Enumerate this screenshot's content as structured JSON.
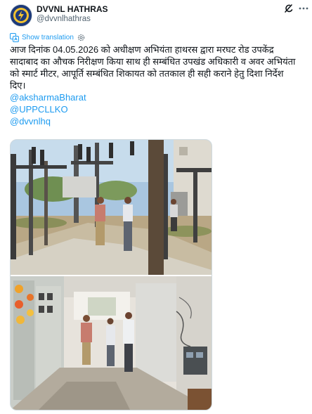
{
  "author": {
    "display_name": "DVVNL HATHRAS",
    "handle": "@dvvnlhathras"
  },
  "header_icons": [
    "grok-icon",
    "more-options-icon"
  ],
  "translation": {
    "label": "Show translation"
  },
  "post": {
    "lines": [
      "आज दिनांक 04.05.2026 को अधीक्षण अभियंता हाथरस द्वारा मरघट रोड उपकेंद्र",
      "सादाबाद का औचक निरीक्षण किया साथ ही सम्बंधित उपखंड अधिकारी व अवर अभियंता",
      "को स्मार्ट मीटर, आपूर्ति सम्बंधित शिकायत को ततकाल ही सही कराने हेतु दिशा निर्देश",
      "दिए।"
    ],
    "mentions": [
      "@aksharmaBharat",
      "@UPPCLLKO",
      "@dvvnlhq"
    ]
  },
  "media": {
    "count": 2,
    "items": [
      "outdoor-substation-photo",
      "indoor-control-room-photo"
    ]
  },
  "colors": {
    "link": "#1d9bf0",
    "text": "#0f1419",
    "muted": "#536471",
    "border": "#cfd9de"
  }
}
